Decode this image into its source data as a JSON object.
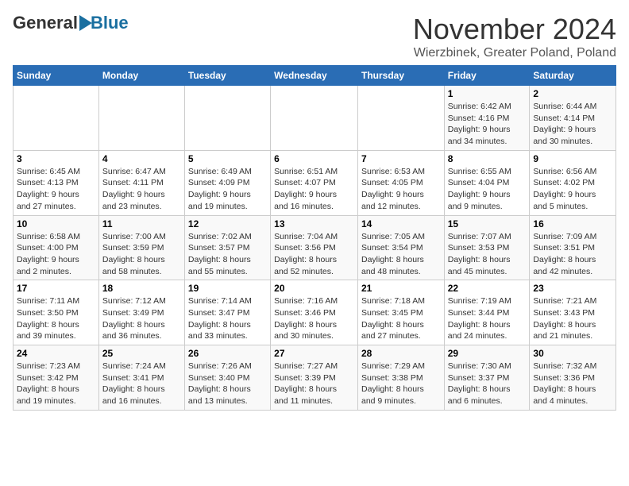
{
  "header": {
    "logo_general": "General",
    "logo_blue": "Blue",
    "title": "November 2024",
    "subtitle": "Wierzbinek, Greater Poland, Poland"
  },
  "calendar": {
    "month": "November 2024",
    "location": "Wierzbinek, Greater Poland, Poland",
    "weekdays": [
      "Sunday",
      "Monday",
      "Tuesday",
      "Wednesday",
      "Thursday",
      "Friday",
      "Saturday"
    ],
    "weeks": [
      [
        {
          "day": "",
          "info": ""
        },
        {
          "day": "",
          "info": ""
        },
        {
          "day": "",
          "info": ""
        },
        {
          "day": "",
          "info": ""
        },
        {
          "day": "",
          "info": ""
        },
        {
          "day": "1",
          "info": "Sunrise: 6:42 AM\nSunset: 4:16 PM\nDaylight: 9 hours\nand 34 minutes."
        },
        {
          "day": "2",
          "info": "Sunrise: 6:44 AM\nSunset: 4:14 PM\nDaylight: 9 hours\nand 30 minutes."
        }
      ],
      [
        {
          "day": "3",
          "info": "Sunrise: 6:45 AM\nSunset: 4:13 PM\nDaylight: 9 hours\nand 27 minutes."
        },
        {
          "day": "4",
          "info": "Sunrise: 6:47 AM\nSunset: 4:11 PM\nDaylight: 9 hours\nand 23 minutes."
        },
        {
          "day": "5",
          "info": "Sunrise: 6:49 AM\nSunset: 4:09 PM\nDaylight: 9 hours\nand 19 minutes."
        },
        {
          "day": "6",
          "info": "Sunrise: 6:51 AM\nSunset: 4:07 PM\nDaylight: 9 hours\nand 16 minutes."
        },
        {
          "day": "7",
          "info": "Sunrise: 6:53 AM\nSunset: 4:05 PM\nDaylight: 9 hours\nand 12 minutes."
        },
        {
          "day": "8",
          "info": "Sunrise: 6:55 AM\nSunset: 4:04 PM\nDaylight: 9 hours\nand 9 minutes."
        },
        {
          "day": "9",
          "info": "Sunrise: 6:56 AM\nSunset: 4:02 PM\nDaylight: 9 hours\nand 5 minutes."
        }
      ],
      [
        {
          "day": "10",
          "info": "Sunrise: 6:58 AM\nSunset: 4:00 PM\nDaylight: 9 hours\nand 2 minutes."
        },
        {
          "day": "11",
          "info": "Sunrise: 7:00 AM\nSunset: 3:59 PM\nDaylight: 8 hours\nand 58 minutes."
        },
        {
          "day": "12",
          "info": "Sunrise: 7:02 AM\nSunset: 3:57 PM\nDaylight: 8 hours\nand 55 minutes."
        },
        {
          "day": "13",
          "info": "Sunrise: 7:04 AM\nSunset: 3:56 PM\nDaylight: 8 hours\nand 52 minutes."
        },
        {
          "day": "14",
          "info": "Sunrise: 7:05 AM\nSunset: 3:54 PM\nDaylight: 8 hours\nand 48 minutes."
        },
        {
          "day": "15",
          "info": "Sunrise: 7:07 AM\nSunset: 3:53 PM\nDaylight: 8 hours\nand 45 minutes."
        },
        {
          "day": "16",
          "info": "Sunrise: 7:09 AM\nSunset: 3:51 PM\nDaylight: 8 hours\nand 42 minutes."
        }
      ],
      [
        {
          "day": "17",
          "info": "Sunrise: 7:11 AM\nSunset: 3:50 PM\nDaylight: 8 hours\nand 39 minutes."
        },
        {
          "day": "18",
          "info": "Sunrise: 7:12 AM\nSunset: 3:49 PM\nDaylight: 8 hours\nand 36 minutes."
        },
        {
          "day": "19",
          "info": "Sunrise: 7:14 AM\nSunset: 3:47 PM\nDaylight: 8 hours\nand 33 minutes."
        },
        {
          "day": "20",
          "info": "Sunrise: 7:16 AM\nSunset: 3:46 PM\nDaylight: 8 hours\nand 30 minutes."
        },
        {
          "day": "21",
          "info": "Sunrise: 7:18 AM\nSunset: 3:45 PM\nDaylight: 8 hours\nand 27 minutes."
        },
        {
          "day": "22",
          "info": "Sunrise: 7:19 AM\nSunset: 3:44 PM\nDaylight: 8 hours\nand 24 minutes."
        },
        {
          "day": "23",
          "info": "Sunrise: 7:21 AM\nSunset: 3:43 PM\nDaylight: 8 hours\nand 21 minutes."
        }
      ],
      [
        {
          "day": "24",
          "info": "Sunrise: 7:23 AM\nSunset: 3:42 PM\nDaylight: 8 hours\nand 19 minutes."
        },
        {
          "day": "25",
          "info": "Sunrise: 7:24 AM\nSunset: 3:41 PM\nDaylight: 8 hours\nand 16 minutes."
        },
        {
          "day": "26",
          "info": "Sunrise: 7:26 AM\nSunset: 3:40 PM\nDaylight: 8 hours\nand 13 minutes."
        },
        {
          "day": "27",
          "info": "Sunrise: 7:27 AM\nSunset: 3:39 PM\nDaylight: 8 hours\nand 11 minutes."
        },
        {
          "day": "28",
          "info": "Sunrise: 7:29 AM\nSunset: 3:38 PM\nDaylight: 8 hours\nand 9 minutes."
        },
        {
          "day": "29",
          "info": "Sunrise: 7:30 AM\nSunset: 3:37 PM\nDaylight: 8 hours\nand 6 minutes."
        },
        {
          "day": "30",
          "info": "Sunrise: 7:32 AM\nSunset: 3:36 PM\nDaylight: 8 hours\nand 4 minutes."
        }
      ]
    ]
  }
}
